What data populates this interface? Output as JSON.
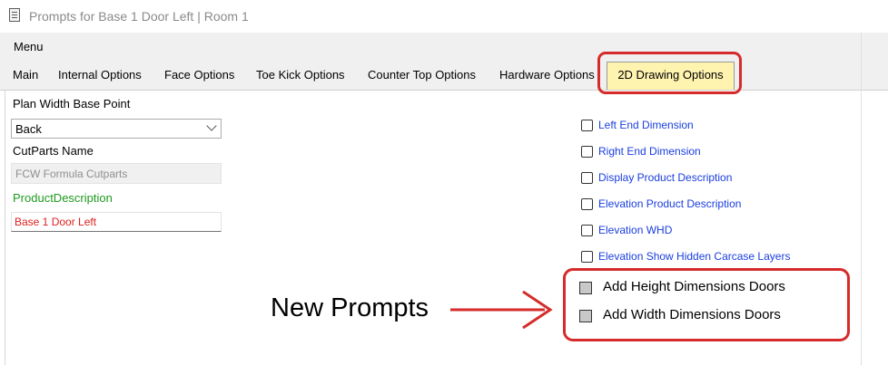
{
  "window": {
    "title": "Prompts for Base 1 Door Left | Room 1"
  },
  "menu": {
    "label": "Menu"
  },
  "tabs": [
    {
      "label": "Main"
    },
    {
      "label": "Internal Options"
    },
    {
      "label": "Face Options"
    },
    {
      "label": "Toe Kick Options"
    },
    {
      "label": "Counter Top Options"
    },
    {
      "label": "Hardware Options"
    },
    {
      "label": "2D Drawing Options",
      "active": true
    }
  ],
  "left": {
    "plan_width_label": "Plan Width Base Point",
    "plan_width_value": "Back",
    "cutparts_label": "CutParts Name",
    "cutparts_value": "FCW Formula Cutparts",
    "product_desc_label": "ProductDescription",
    "product_desc_value": "Base 1 Door Left",
    "colors": {
      "product_desc_label": "#1e9a1e",
      "product_desc_value": "#e02020"
    }
  },
  "checkboxes": [
    {
      "label": "Left End Dimension",
      "checked": false
    },
    {
      "label": "Right End Dimension",
      "checked": false
    },
    {
      "label": "Display Product Description",
      "checked": false
    },
    {
      "label": "Elevation Product Description",
      "checked": false
    },
    {
      "label": "Elevation WHD",
      "checked": false
    },
    {
      "label": "Elevation Show Hidden Carcase Layers",
      "checked": false
    }
  ],
  "new_checkboxes": [
    {
      "label": "Add Height Dimensions Doors",
      "checked": false
    },
    {
      "label": "Add Width Dimensions Doors",
      "checked": false
    }
  ],
  "annotation": {
    "text": "New Prompts",
    "color": "#d62b2b"
  },
  "colors": {
    "highlight_tab": "#fff3b0",
    "link_text": "#1a3ee0"
  }
}
